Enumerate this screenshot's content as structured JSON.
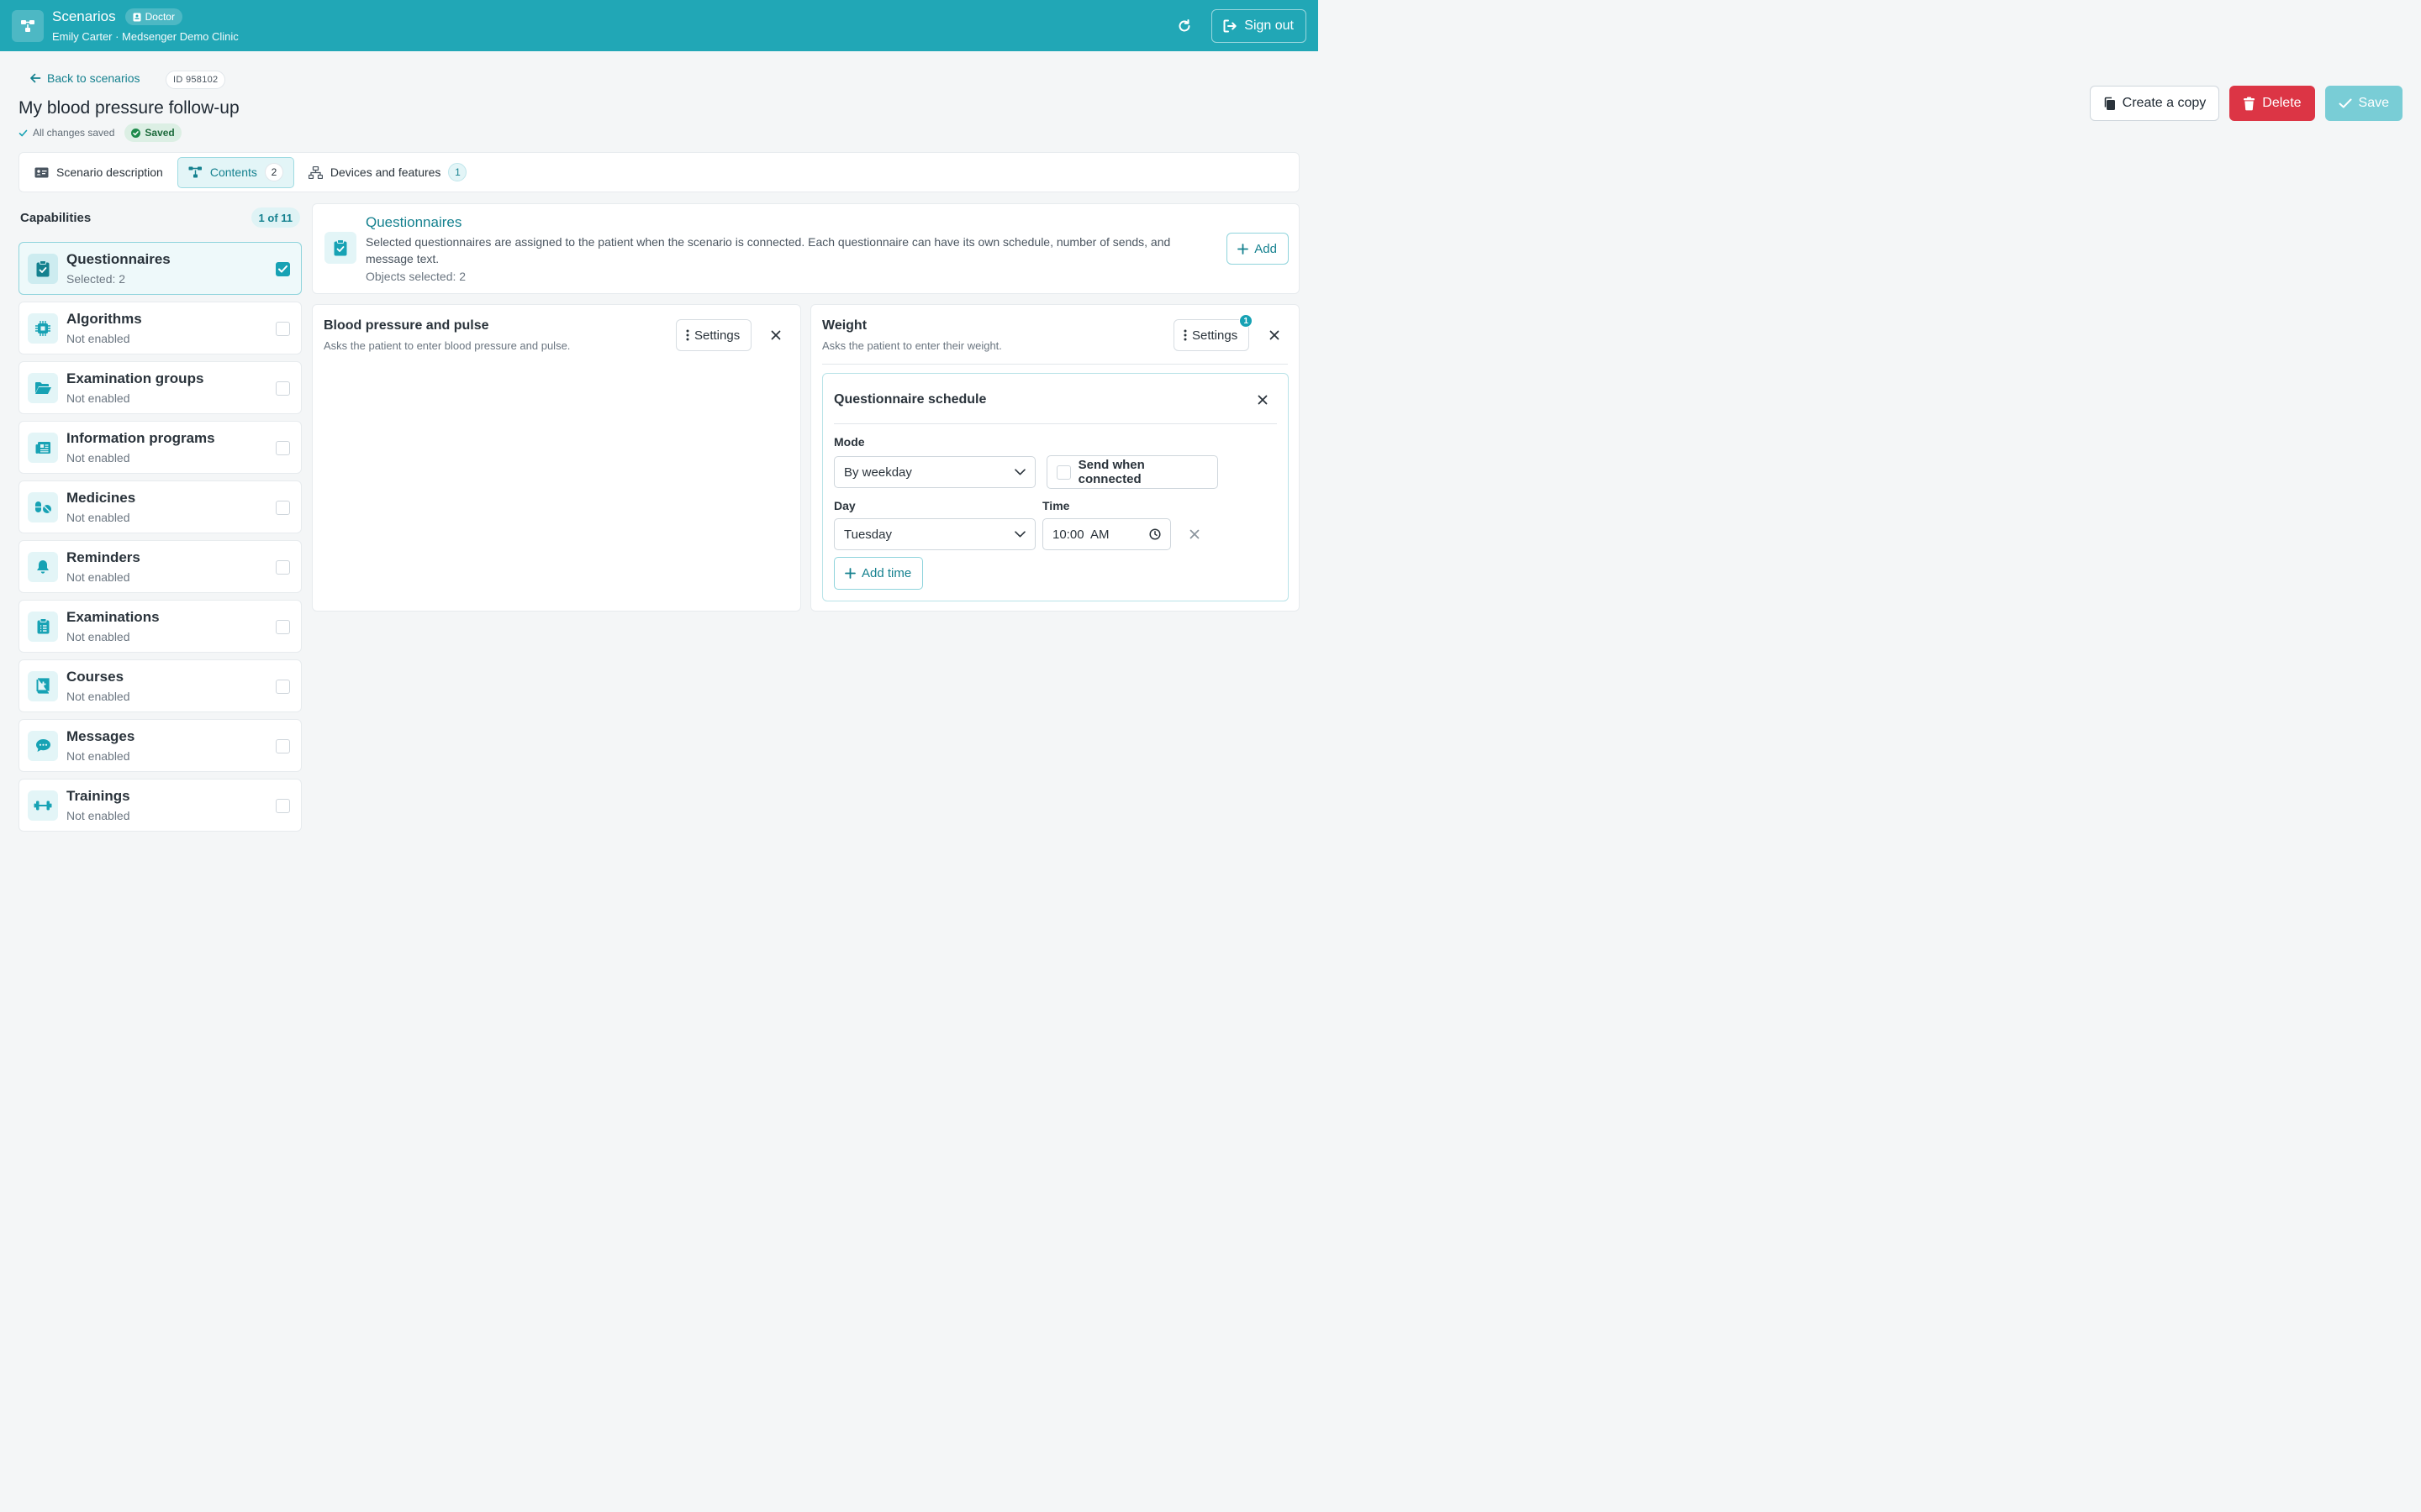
{
  "header": {
    "app_title": "Scenarios",
    "role": "Doctor",
    "user_line": "Emily Carter · Medsenger Demo Clinic",
    "sign_out": "Sign out"
  },
  "page": {
    "back_link": "Back to scenarios",
    "id_badge": "ID 958102",
    "title": "My blood pressure follow-up",
    "autosave_text": "All changes saved",
    "saved_badge": "Saved"
  },
  "actions": {
    "copy": "Create a copy",
    "delete": "Delete",
    "save": "Save"
  },
  "tabs": [
    {
      "label": "Scenario description",
      "count": null,
      "active": false
    },
    {
      "label": "Contents",
      "count": "2",
      "active": true
    },
    {
      "label": "Devices and features",
      "count": "1",
      "active": false
    }
  ],
  "capabilities": {
    "title": "Capabilities",
    "count": "1 of 11",
    "items": [
      {
        "name": "Questionnaires",
        "status": "Selected: 2",
        "checked": true,
        "icon": "clipboard-check-icon"
      },
      {
        "name": "Algorithms",
        "status": "Not enabled",
        "checked": false,
        "icon": "cpu-chip-icon"
      },
      {
        "name": "Examination groups",
        "status": "Not enabled",
        "checked": false,
        "icon": "folder-open-icon"
      },
      {
        "name": "Information programs",
        "status": "Not enabled",
        "checked": false,
        "icon": "newspaper-icon"
      },
      {
        "name": "Medicines",
        "status": "Not enabled",
        "checked": false,
        "icon": "pills-icon"
      },
      {
        "name": "Reminders",
        "status": "Not enabled",
        "checked": false,
        "icon": "bell-icon"
      },
      {
        "name": "Examinations",
        "status": "Not enabled",
        "checked": false,
        "icon": "clipboard-list-icon"
      },
      {
        "name": "Courses",
        "status": "Not enabled",
        "checked": false,
        "icon": "book-medical-icon"
      },
      {
        "name": "Messages",
        "status": "Not enabled",
        "checked": false,
        "icon": "chat-bubble-icon"
      },
      {
        "name": "Trainings",
        "status": "Not enabled",
        "checked": false,
        "icon": "dumbbell-icon"
      }
    ]
  },
  "info": {
    "title": "Questionnaires",
    "description": "Selected questionnaires are assigned to the patient when the scenario is connected. Each questionnaire can have its own schedule, number of sends, and message text.",
    "selected": "Objects selected: 2",
    "add": "Add"
  },
  "questionnaires": [
    {
      "title": "Blood pressure and pulse",
      "description": "Asks the patient to enter blood pressure and pulse.",
      "settings": "Settings"
    },
    {
      "title": "Weight",
      "description": "Asks the patient to enter their weight.",
      "settings": "Settings",
      "badge": "1"
    }
  ],
  "schedule": {
    "title": "Questionnaire schedule",
    "mode_label": "Mode",
    "mode_value": "By weekday",
    "send_when_connected": "Send when connected",
    "day_label": "Day",
    "day_value": "Tuesday",
    "time_label": "Time",
    "time_value": "10:00  AM",
    "add_time": "Add time"
  },
  "colors": {
    "brand": "#21a7b6",
    "accent": "#17a2b4",
    "danger": "#dc3545"
  }
}
